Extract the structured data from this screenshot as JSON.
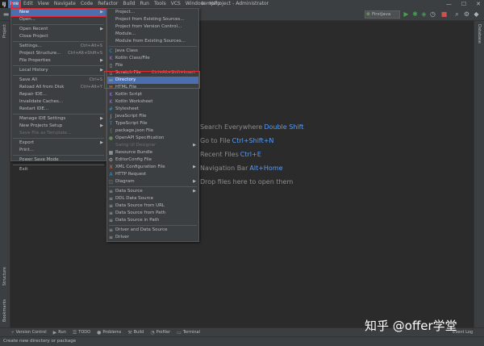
{
  "app_logo": "IJ",
  "menubar": {
    "items": [
      "File",
      "Edit",
      "View",
      "Navigate",
      "Code",
      "Refactor",
      "Build",
      "Run",
      "Tools",
      "VCS",
      "Window",
      "Help"
    ],
    "window_title": "tempProject - Administrator"
  },
  "toolbar": {
    "run_config": "FirstJava"
  },
  "left_stripe": {
    "project": "Project",
    "structure": "Structure",
    "bookmarks": "Bookmarks"
  },
  "right_stripe": {
    "database": "Database"
  },
  "file_menu": {
    "items": [
      {
        "label": "New",
        "selected": true,
        "submenu": true
      },
      {
        "label": "Open..."
      },
      {
        "sep": true
      },
      {
        "label": "Open Recent",
        "submenu": true
      },
      {
        "label": "Close Project"
      },
      {
        "sep": true
      },
      {
        "label": "Settings...",
        "shortcut": "Ctrl+Alt+S"
      },
      {
        "label": "Project Structure...",
        "shortcut": "Ctrl+Alt+Shift+S"
      },
      {
        "label": "File Properties",
        "submenu": true
      },
      {
        "sep": true
      },
      {
        "label": "Local History",
        "submenu": true
      },
      {
        "sep": true
      },
      {
        "label": "Save All",
        "shortcut": "Ctrl+S"
      },
      {
        "label": "Reload All from Disk",
        "shortcut": "Ctrl+Alt+Y"
      },
      {
        "label": "Repair IDE..."
      },
      {
        "label": "Invalidate Caches..."
      },
      {
        "label": "Restart IDE..."
      },
      {
        "sep": true
      },
      {
        "label": "Manage IDE Settings",
        "submenu": true
      },
      {
        "label": "New Projects Setup",
        "submenu": true
      },
      {
        "label": "Save File as Template...",
        "disabled": true
      },
      {
        "sep": true
      },
      {
        "label": "Export",
        "submenu": true
      },
      {
        "label": "Print..."
      },
      {
        "sep": true
      },
      {
        "label": "Power Save Mode"
      },
      {
        "sep": true
      },
      {
        "label": "Exit"
      }
    ]
  },
  "new_submenu": {
    "items": [
      {
        "label": "Project..."
      },
      {
        "label": "Project from Existing Sources..."
      },
      {
        "label": "Project from Version Control..."
      },
      {
        "label": "Module..."
      },
      {
        "label": "Module from Existing Sources..."
      },
      {
        "sep": true
      },
      {
        "label": "Java Class",
        "icon": "java-class-icon",
        "glyph": "C",
        "color": "#3592c4"
      },
      {
        "label": "Kotlin Class/File",
        "icon": "kotlin-icon",
        "glyph": "K",
        "color": "#9a73d8"
      },
      {
        "label": "File",
        "icon": "file-icon",
        "glyph": "▯",
        "color": "#afb1b3"
      },
      {
        "label": "Scratch File",
        "shortcut": "Ctrl+Alt+Shift+Insert",
        "icon": "scratch-file-icon",
        "glyph": "▯",
        "color": "#afb1b3"
      },
      {
        "label": "Directory",
        "selected": true,
        "icon": "folder-icon",
        "glyph": "▬",
        "color": "#87939a"
      },
      {
        "label": "HTML File",
        "icon": "html-icon",
        "glyph": "H",
        "color": "#e8754a"
      },
      {
        "label": "Kotlin Script",
        "icon": "kotlin-script-icon",
        "glyph": "K",
        "color": "#9a73d8"
      },
      {
        "label": "Kotlin Worksheet",
        "icon": "kotlin-worksheet-icon",
        "glyph": "K",
        "color": "#9a73d8"
      },
      {
        "label": "Stylesheet",
        "icon": "css-icon",
        "glyph": "#",
        "color": "#3592c4"
      },
      {
        "label": "JavaScript File",
        "icon": "javascript-icon",
        "glyph": "J",
        "color": "#d9a343"
      },
      {
        "label": "TypeScript File",
        "icon": "typescript-icon",
        "glyph": "T",
        "color": "#3592c4"
      },
      {
        "label": "package.json File",
        "icon": "package-json-icon",
        "glyph": "{",
        "color": "#6a8759"
      },
      {
        "label": "OpenAPI Specification",
        "icon": "openapi-icon",
        "glyph": "●",
        "color": "#6a8759"
      },
      {
        "label": "Swing UI Designer",
        "disabled": true,
        "submenu": true
      },
      {
        "label": "Resource Bundle",
        "icon": "resource-bundle-icon",
        "glyph": "▦",
        "color": "#afb1b3"
      },
      {
        "label": "EditorConfig File",
        "icon": "editorconfig-icon",
        "glyph": "⚙",
        "color": "#afb1b3"
      },
      {
        "label": "XML Configuration File",
        "submenu": true,
        "icon": "xml-icon",
        "glyph": "X",
        "color": "#e8754a"
      },
      {
        "label": "HTTP Request",
        "icon": "http-request-icon",
        "glyph": "A",
        "color": "#3592c4"
      },
      {
        "label": "Diagram",
        "submenu": true,
        "icon": "diagram-icon",
        "glyph": "◫",
        "color": "#3592c4"
      },
      {
        "sep": true
      },
      {
        "label": "Data Source",
        "submenu": true,
        "icon": "data-source-icon",
        "glyph": "≡",
        "color": "#afb1b3"
      },
      {
        "label": "DDL Data Source",
        "icon": "ddl-icon",
        "glyph": "≡",
        "color": "#afb1b3"
      },
      {
        "label": "Data Source from URL",
        "icon": "data-source-url-icon",
        "glyph": "≡",
        "color": "#afb1b3"
      },
      {
        "label": "Data Source from Path",
        "icon": "data-source-path-icon",
        "glyph": "≡",
        "color": "#afb1b3"
      },
      {
        "label": "Data Source in Path",
        "icon": "data-source-in-path-icon",
        "glyph": "≡",
        "color": "#afb1b3"
      },
      {
        "sep": true
      },
      {
        "label": "Driver and Data Source",
        "icon": "driver-data-source-icon",
        "glyph": "≡",
        "color": "#afb1b3"
      },
      {
        "label": "Driver",
        "icon": "driver-icon",
        "glyph": "≡",
        "color": "#afb1b3"
      }
    ]
  },
  "editor_hints": [
    {
      "text": "Search Everywhere",
      "key": "Double Shift"
    },
    {
      "text": "Go to File",
      "key": "Ctrl+Shift+N"
    },
    {
      "text": "Recent Files",
      "key": "Ctrl+E"
    },
    {
      "text": "Navigation Bar",
      "key": "Alt+Home"
    },
    {
      "text": "Drop files here to open them",
      "key": ""
    }
  ],
  "bottom_tabs": [
    {
      "label": "Version Control",
      "icon": "branch-icon",
      "glyph": "⑂"
    },
    {
      "label": "Run",
      "icon": "run-icon",
      "glyph": "▶"
    },
    {
      "label": "TODO",
      "icon": "todo-icon",
      "glyph": "☰"
    },
    {
      "label": "Problems",
      "icon": "problems-icon",
      "glyph": "●"
    },
    {
      "label": "Build",
      "icon": "build-icon",
      "glyph": "⚒"
    },
    {
      "label": "Profiler",
      "icon": "profiler-icon",
      "glyph": "◔"
    },
    {
      "label": "Terminal",
      "icon": "terminal-icon",
      "glyph": "▭"
    }
  ],
  "event_log": "Event Log",
  "status_text": "Create new directory or package",
  "watermark": "知乎 @offer学堂",
  "colors": {
    "selection": "#4b6eaf",
    "highlight_box": "#e8262d",
    "shortcut_key": "#589df6"
  }
}
